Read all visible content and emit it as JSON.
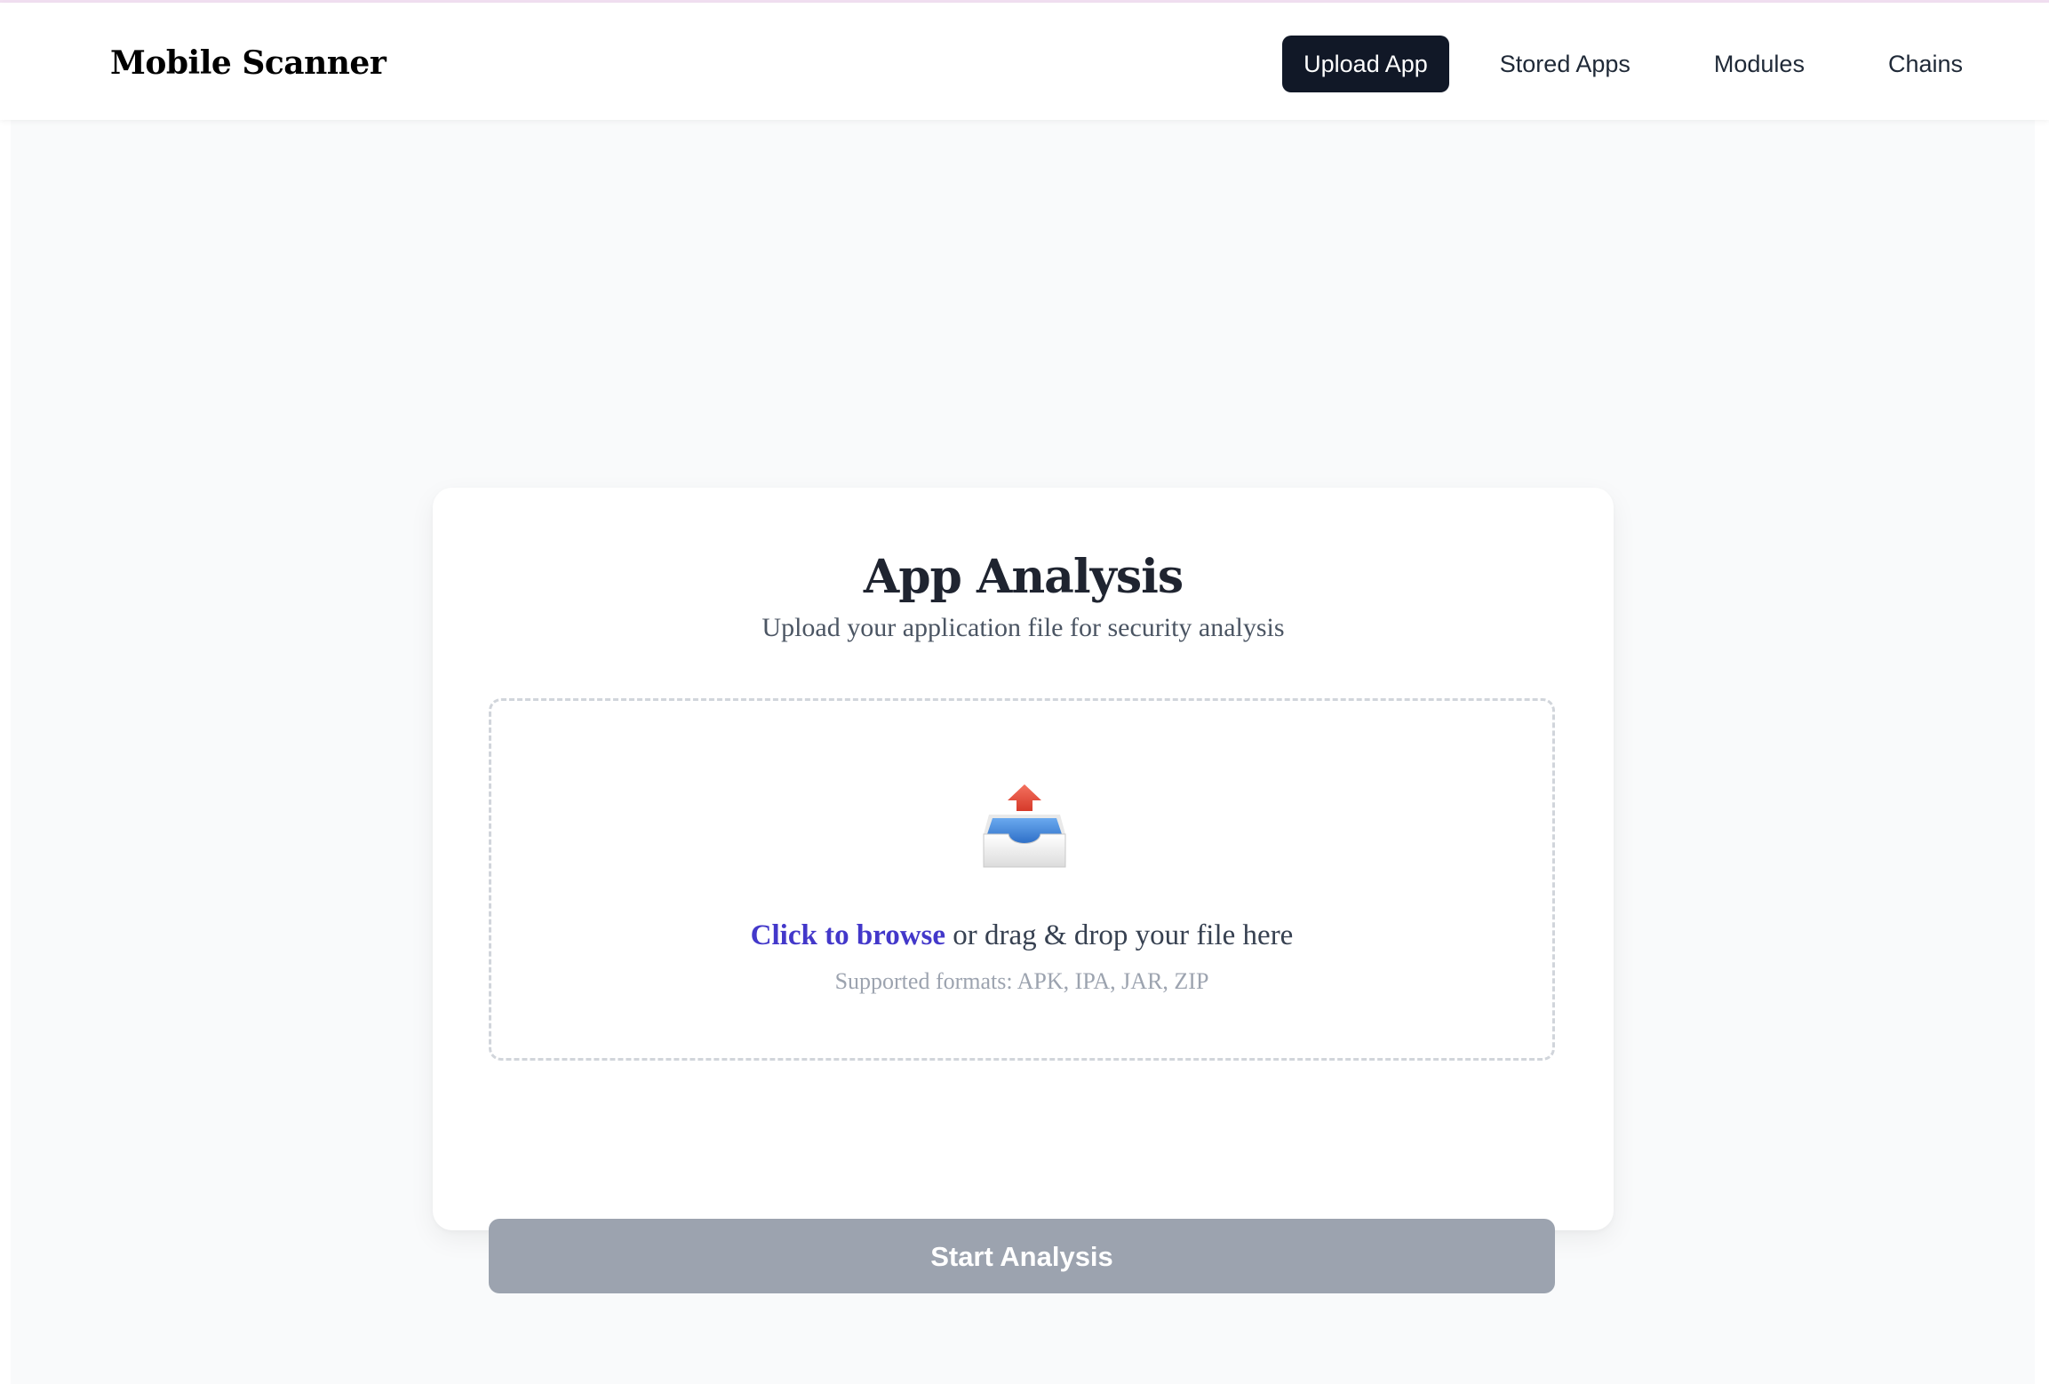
{
  "header": {
    "brand": "Mobile Scanner",
    "nav": [
      {
        "label": "Upload App",
        "active": true
      },
      {
        "label": "Stored Apps",
        "active": false
      },
      {
        "label": "Modules",
        "active": false
      },
      {
        "label": "Chains",
        "active": false
      }
    ]
  },
  "card": {
    "title": "App Analysis",
    "subtitle": "Upload your application file for security analysis",
    "dropzone": {
      "icon": "outbox-tray-icon",
      "browse_label": "Click to browse",
      "drop_text": " or drag & drop your file here",
      "formats": "Supported formats: APK, IPA, JAR, ZIP"
    },
    "start_button": "Start Analysis"
  },
  "colors": {
    "nav_active_bg": "#111827",
    "link": "#4338ca",
    "button_disabled": "#9ca3af",
    "page_bg": "#f9fafb"
  }
}
